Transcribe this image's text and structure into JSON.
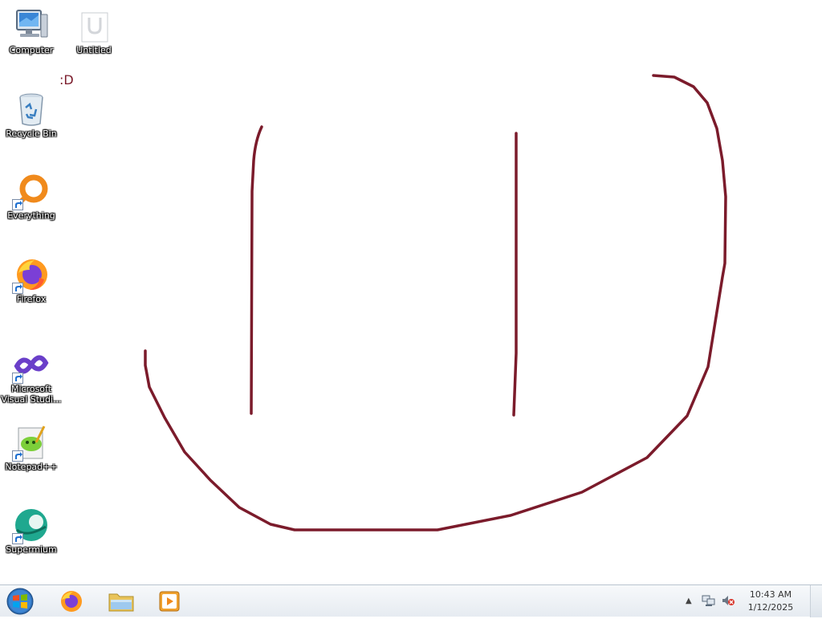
{
  "desktop": {
    "icons": [
      {
        "label": "Computer",
        "icon": "computer-icon"
      },
      {
        "label": "Untitled",
        "icon": "document-icon"
      },
      {
        "label": "Recycle Bin",
        "icon": "recycle-bin-icon"
      },
      {
        "label": "Everything",
        "icon": "everything-icon"
      },
      {
        "label": "Firefox",
        "icon": "firefox-icon"
      },
      {
        "label": "Microsoft Visual Studi...",
        "icon": "visual-studio-icon"
      },
      {
        "label": "Notepad++",
        "icon": "notepad-plus-plus-icon"
      },
      {
        "label": "Supermium",
        "icon": "supermium-icon"
      }
    ],
    "smiley_text": ":D",
    "drawing_color": "#7b1b2b"
  },
  "taskbar": {
    "pinned": [
      {
        "name": "firefox",
        "icon": "firefox-icon"
      },
      {
        "name": "file-explorer",
        "icon": "folder-icon"
      },
      {
        "name": "media-player",
        "icon": "media-player-icon"
      }
    ],
    "tray": {
      "time": "10:43 AM",
      "date": "1/12/2025"
    }
  }
}
